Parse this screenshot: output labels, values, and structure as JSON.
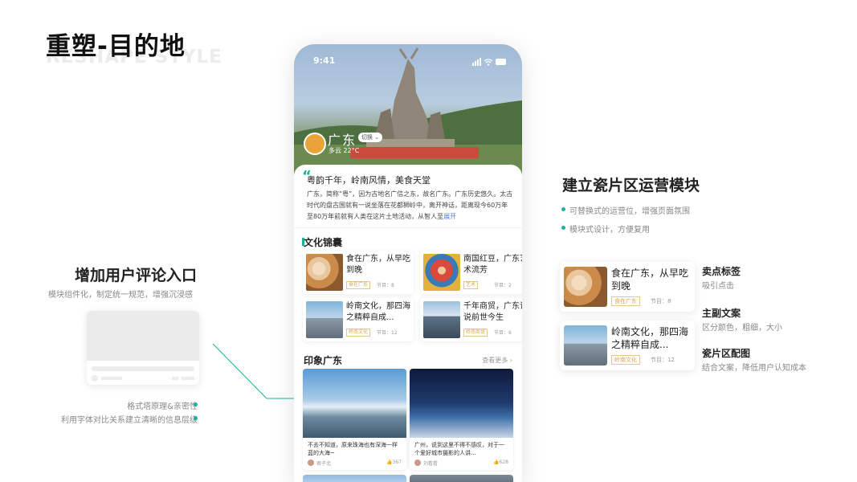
{
  "page": {
    "title": "重塑-目的地",
    "subtitle": "RESHAPE STYLE"
  },
  "left": {
    "heading": "增加用户评论入口",
    "desc": "模块组件化，制定统一规范，增强沉浸感",
    "bullets": [
      "格式塔原理&亲密性",
      "利用字体对比关系建立清晰的信息层级"
    ]
  },
  "right": {
    "heading": "建立瓷片区运营模块",
    "bullets": [
      "可替换式的运营位，增强页面氛围",
      "模块式设计，方便复用"
    ],
    "cards": [
      {
        "title": "食在广东，从早吃到晚",
        "tag": "食在广东",
        "count": "节目：8"
      },
      {
        "title": "岭南文化，那四海之精粹自成...",
        "tag": "岭南文化",
        "count": "节目：12"
      }
    ],
    "features": [
      {
        "title": "卖点标签",
        "desc": "吸引点击"
      },
      {
        "title": "主副文案",
        "desc": "区分颜色，粗细，大小"
      },
      {
        "title": "瓷片区配图",
        "desc": "结合文案，降低用户认知成本"
      }
    ]
  },
  "phone": {
    "time": "9:41",
    "city": "广东",
    "switch": "切换",
    "weather": "多云  22°C",
    "intro_title": "粤韵千年，岭南风情，美食天堂",
    "intro_text": "广东，简称“粤”，因为古地名广信之东，故名广东。广东历史悠久。太古时代的盘古国就有一说坐落在花都狮岭中，离开神话，距离现今60万年至80万年前就有人类在这片土地活动，从智人至",
    "more": "展开",
    "section1": "文化锦囊",
    "tiles": [
      {
        "title": "食在广东，从早吃到晚",
        "tag": "食在广东",
        "count": "节目：8"
      },
      {
        "title": "南国红豆，广东艺术流芳",
        "tag": "艺术",
        "count": "节目：2"
      },
      {
        "title": "岭南文化，那四海之精粹自成...",
        "tag": "岭南文化",
        "count": "节目：12"
      },
      {
        "title": "千年商贸，广东诉说前世今生",
        "tag": "岭南商贸",
        "count": "节目：6"
      }
    ],
    "section2": "印象广东",
    "see_more": "查看更多 ›",
    "posts": [
      {
        "text": "不去不知道，原来珠海也有深海一样蓝的大海~",
        "user": "君子北",
        "likes": "367"
      },
      {
        "text": "广州，说到这里不得不感叹，对于一个爱好城市摄影的人讲...",
        "user": "刘看看",
        "likes": "628"
      }
    ]
  },
  "colors": {
    "accent": "#1bb39a",
    "tag": "#d7a45a",
    "link": "#4f82d8"
  }
}
